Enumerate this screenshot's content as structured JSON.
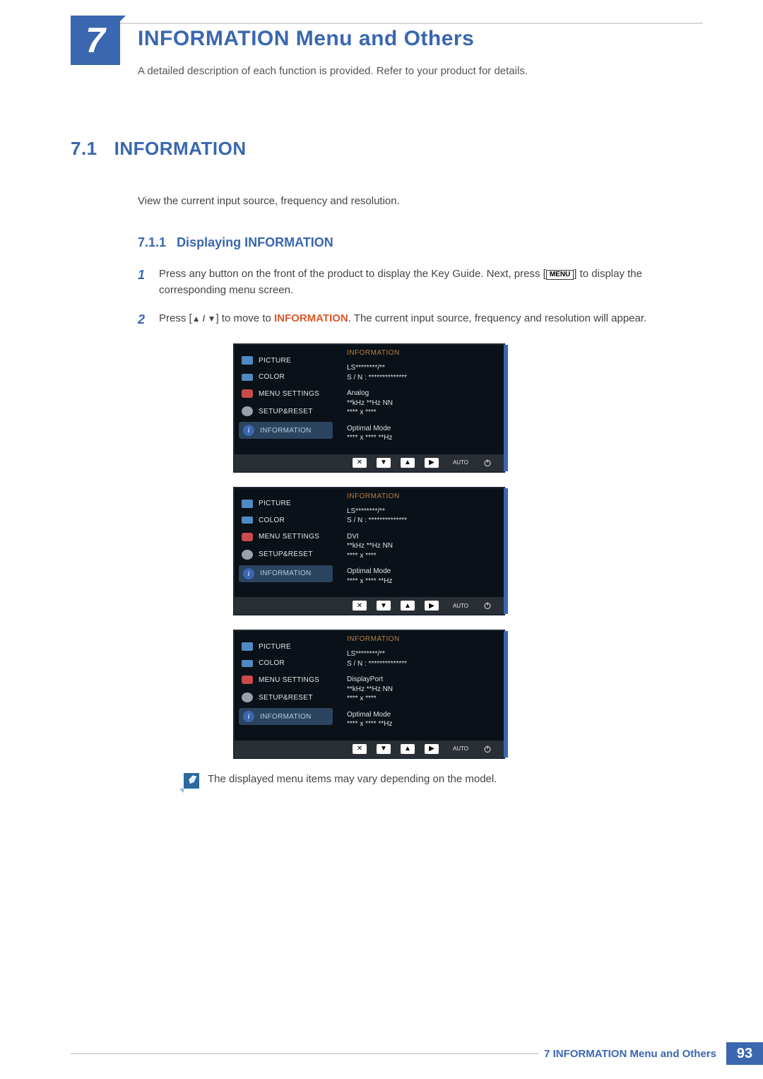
{
  "chapter": {
    "num": "7",
    "title": "INFORMATION Menu and Others",
    "sub": "A detailed description of each function is provided. Refer to your product for details."
  },
  "section": {
    "num": "7.1",
    "title": "INFORMATION",
    "body": "View the current input source, frequency and resolution."
  },
  "subsection": {
    "num": "7.1.1",
    "title": "Displaying INFORMATION"
  },
  "steps": {
    "s1": {
      "num": "1",
      "pre": "Press any button on the front of the product to display the Key Guide. Next, press [",
      "btn": "MENU",
      "post": "] to display the corresponding menu screen."
    },
    "s2": {
      "num": "2",
      "pre": "Press [",
      "arrows": "▲ / ▼",
      "mid": "] to move to ",
      "kw": "INFORMATION",
      "post": ". The current input source, frequency and resolution will appear."
    }
  },
  "osd": {
    "left": {
      "picture": "PICTURE",
      "color": "COLOR",
      "menu": "MENU SETTINGS",
      "setup": "SETUP&RESET",
      "info": "INFORMATION"
    },
    "hdr": "INFORMATION",
    "model": "LS********/**",
    "sn": "S / N : **************",
    "freq": "**kHz **Hz NN",
    "res": "**** x ****",
    "opt_lbl": "Optimal Mode",
    "opt_val": "**** x **** **Hz",
    "source": {
      "analog": "Analog",
      "dvi": "DVI",
      "dp": "DisplayPort"
    },
    "bar": {
      "auto": "AUTO"
    }
  },
  "note": "The displayed menu items may vary depending on the model.",
  "footer": {
    "label": "7 INFORMATION Menu and Others",
    "page": "93"
  }
}
